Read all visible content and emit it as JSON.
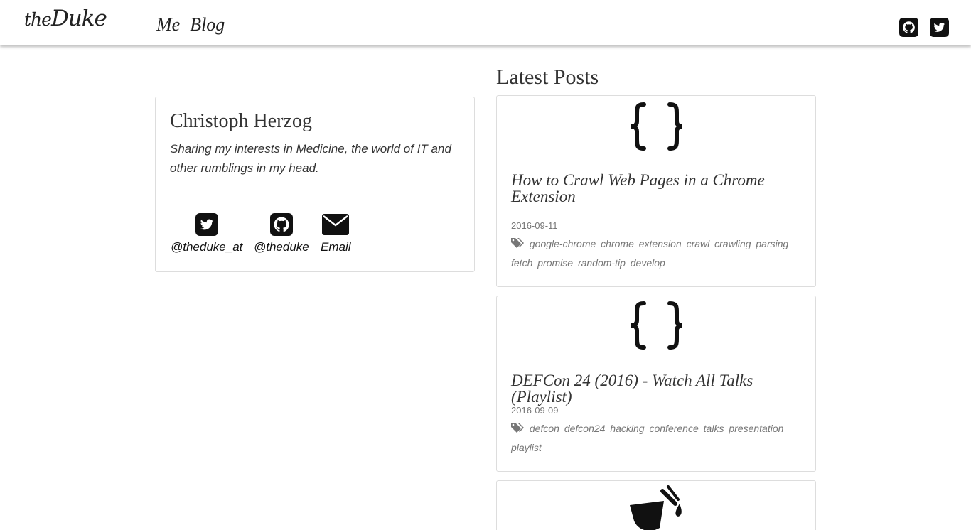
{
  "header": {
    "brand_prefix": "the",
    "brand_name": "Duke",
    "nav": [
      "Me",
      "Blog"
    ],
    "icons": [
      "github-icon",
      "twitter-icon"
    ]
  },
  "profile": {
    "name": "Christoph Herzog",
    "tagline": "Sharing my interests in Medicine, the world of IT and other rumblings in my head.",
    "social": [
      {
        "icon": "twitter-icon",
        "label": "@theduke_at"
      },
      {
        "icon": "github-icon",
        "label": "@theduke"
      },
      {
        "icon": "envelope-icon",
        "label": "Email"
      }
    ]
  },
  "latest": {
    "heading": "Latest Posts",
    "posts": [
      {
        "icon": "code-braces-icon",
        "title": "How to Crawl Web Pages in a Chrome Extension",
        "date": "2016-09-11",
        "tags": [
          "google-chrome",
          "chrome",
          "extension",
          "crawl",
          "crawling",
          "parsing",
          "fetch",
          "promise",
          "random-tip",
          "develop"
        ]
      },
      {
        "icon": "code-braces-icon",
        "title": "DEFCon 24 (2016) - Watch All Talks (Playlist)",
        "date": "2016-09-09",
        "tags": [
          "defcon",
          "defcon24",
          "hacking",
          "conference",
          "talks",
          "presentation",
          "playlist"
        ]
      },
      {
        "icon": "paint-bucket-icon"
      }
    ]
  },
  "colors": {
    "text": "#333333",
    "muted": "#777777",
    "border": "#dddddd",
    "icon": "#111111"
  }
}
